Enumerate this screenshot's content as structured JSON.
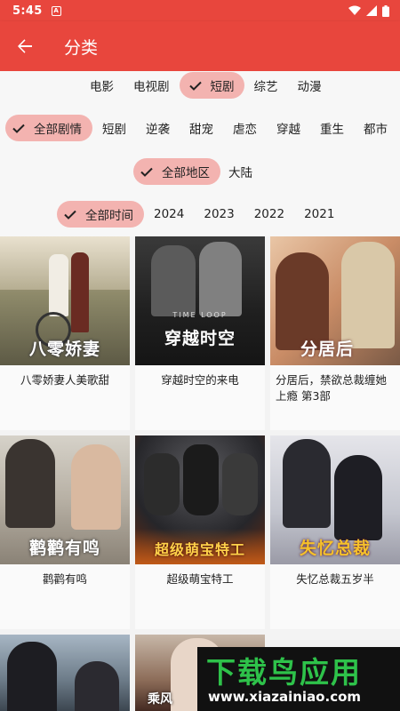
{
  "status": {
    "time": "5:45",
    "notif": "A"
  },
  "appbar": {
    "title": "分类"
  },
  "filters": {
    "type": [
      "电影",
      "电视剧",
      "短剧",
      "综艺",
      "动漫"
    ],
    "genre": [
      "全部剧情",
      "短剧",
      "逆袭",
      "甜宠",
      "虐恋",
      "穿越",
      "重生",
      "都市"
    ],
    "region": [
      "全部地区",
      "大陆"
    ],
    "year": [
      "全部时间",
      "2024",
      "2023",
      "2022",
      "2021"
    ]
  },
  "cards": [
    {
      "title": "八零娇妻人美歌甜",
      "poster_text": "八零娇妻"
    },
    {
      "title": "穿越时空的来电",
      "poster_text": "穿越时空",
      "poster_sub": "TIME LOOP"
    },
    {
      "title": "分居后，禁欲总裁缠她上瘾 第3部",
      "poster_text": "分居后"
    },
    {
      "title": "鹳鹳有鸣",
      "poster_text": "鹳鹳有鸣"
    },
    {
      "title": "超级萌宝特工",
      "poster_text": "超级萌宝特工"
    },
    {
      "title": "失忆总裁五岁半",
      "poster_text": "失忆总裁"
    },
    {
      "title": "",
      "poster_text": ""
    },
    {
      "title": "",
      "poster_text": "乘风"
    }
  ],
  "watermark": {
    "main": "下载鸟应用",
    "sub": "www.xiazainiao.com"
  },
  "colors": {
    "accent": "#e8463d",
    "chip_selected": "#f3b3b0",
    "watermark_green": "#2ec24a"
  }
}
